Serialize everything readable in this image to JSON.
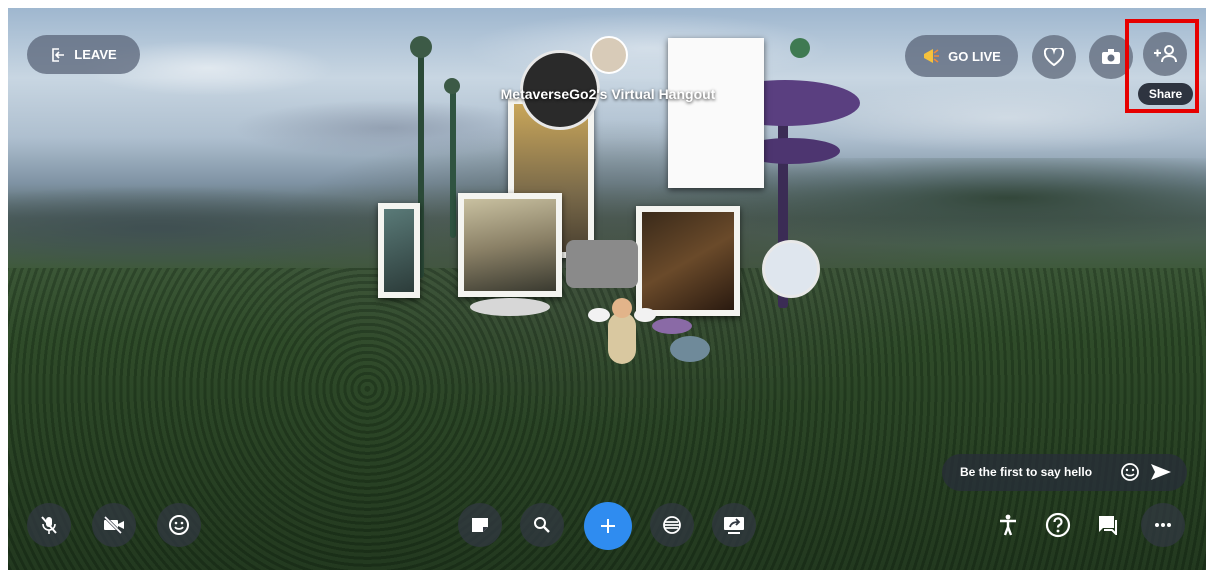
{
  "header": {
    "leave_label": "LEAVE",
    "go_live_label": "GO LIVE",
    "room_title": "MetaverseGo2's Virtual Hangout",
    "share_tooltip": "Share"
  },
  "icons": {
    "leave": "leave-arrow-icon",
    "go_live": "megaphone-icon",
    "favorite": "heart-icon",
    "camera": "camera-icon",
    "share": "add-person-icon",
    "mic": "mic-off-icon",
    "video": "video-off-icon",
    "reactions": "smiley-icon",
    "sticky": "sticky-note-icon",
    "search": "search-icon",
    "add": "plus-icon",
    "filter": "filter-lines-icon",
    "share_screen": "share-screen-icon",
    "accessibility": "accessibility-icon",
    "help": "help-icon",
    "chat_toggle": "chat-bubble-icon",
    "more": "more-dots-icon",
    "chat_emoji": "smiley-icon",
    "chat_send": "send-icon"
  },
  "chat": {
    "placeholder": "Be the first to say hello"
  },
  "colors": {
    "accent_blue": "#2f8cf0",
    "highlight_red": "#e60000",
    "button_dark": "#323842",
    "button_light": "#646e80"
  }
}
